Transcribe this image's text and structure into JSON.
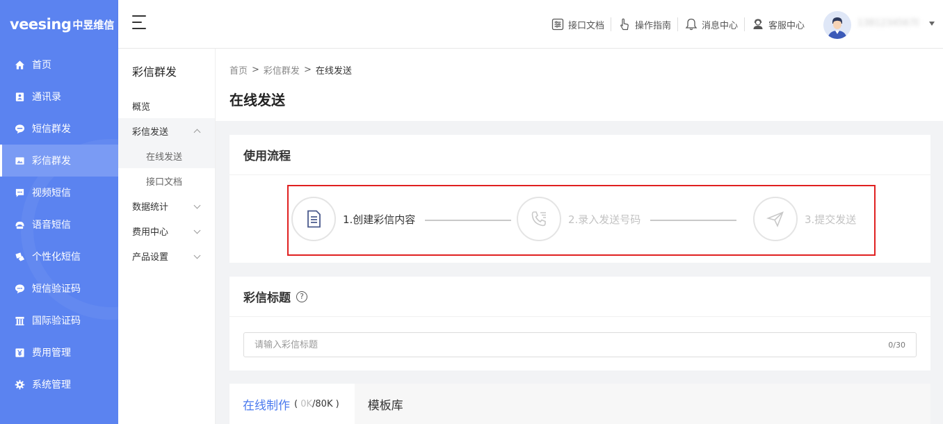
{
  "brand": {
    "word": "veesing",
    "cn": "中昱维信"
  },
  "sidebar": {
    "items": [
      {
        "label": "首页",
        "icon": "home-icon"
      },
      {
        "label": "通讯录",
        "icon": "contacts-icon"
      },
      {
        "label": "短信群发",
        "icon": "sms-icon"
      },
      {
        "label": "彩信群发",
        "icon": "image-message-icon",
        "active": true
      },
      {
        "label": "视频短信",
        "icon": "video-message-icon"
      },
      {
        "label": "语音短信",
        "icon": "voice-message-icon"
      },
      {
        "label": "个性化短信",
        "icon": "personalized-message-icon"
      },
      {
        "label": "短信验证码",
        "icon": "verify-code-icon"
      },
      {
        "label": "国际验证码",
        "icon": "international-code-icon"
      },
      {
        "label": "费用管理",
        "icon": "yen-icon"
      },
      {
        "label": "系统管理",
        "icon": "gear-icon"
      }
    ]
  },
  "header": {
    "links": [
      {
        "label": "接口文档",
        "icon": "api-doc-icon"
      },
      {
        "label": "操作指南",
        "icon": "hand-pointer-icon"
      },
      {
        "label": "消息中心",
        "icon": "bell-icon"
      },
      {
        "label": "客服中心",
        "icon": "customer-service-icon"
      }
    ],
    "username": "13812345678"
  },
  "subnav": {
    "title": "彩信群发",
    "overview": "概览",
    "send": "彩信发送",
    "send_children": [
      "在线发送",
      "接口文档"
    ],
    "stats": "数据统计",
    "cost": "费用中心",
    "settings": "产品设置"
  },
  "breadcrumb": {
    "home": "首页",
    "section": "彩信群发",
    "current": "在线发送"
  },
  "page_title": "在线发送",
  "flow": {
    "title": "使用流程",
    "steps": [
      {
        "label": "1.创建彩信内容",
        "icon": "document-icon"
      },
      {
        "label": "2.录入发送号码",
        "icon": "phone-list-icon"
      },
      {
        "label": "3.提交发送",
        "icon": "send-plane-icon"
      }
    ]
  },
  "title_field": {
    "heading": "彩信标题",
    "help": "?",
    "placeholder": "请输入彩信标题",
    "value": "",
    "counter": "0/30"
  },
  "tabs": {
    "online": "在线制作",
    "online_open": "(",
    "online_used": "0K",
    "online_total": "/80K",
    "online_close": ")",
    "templates": "模板库"
  }
}
